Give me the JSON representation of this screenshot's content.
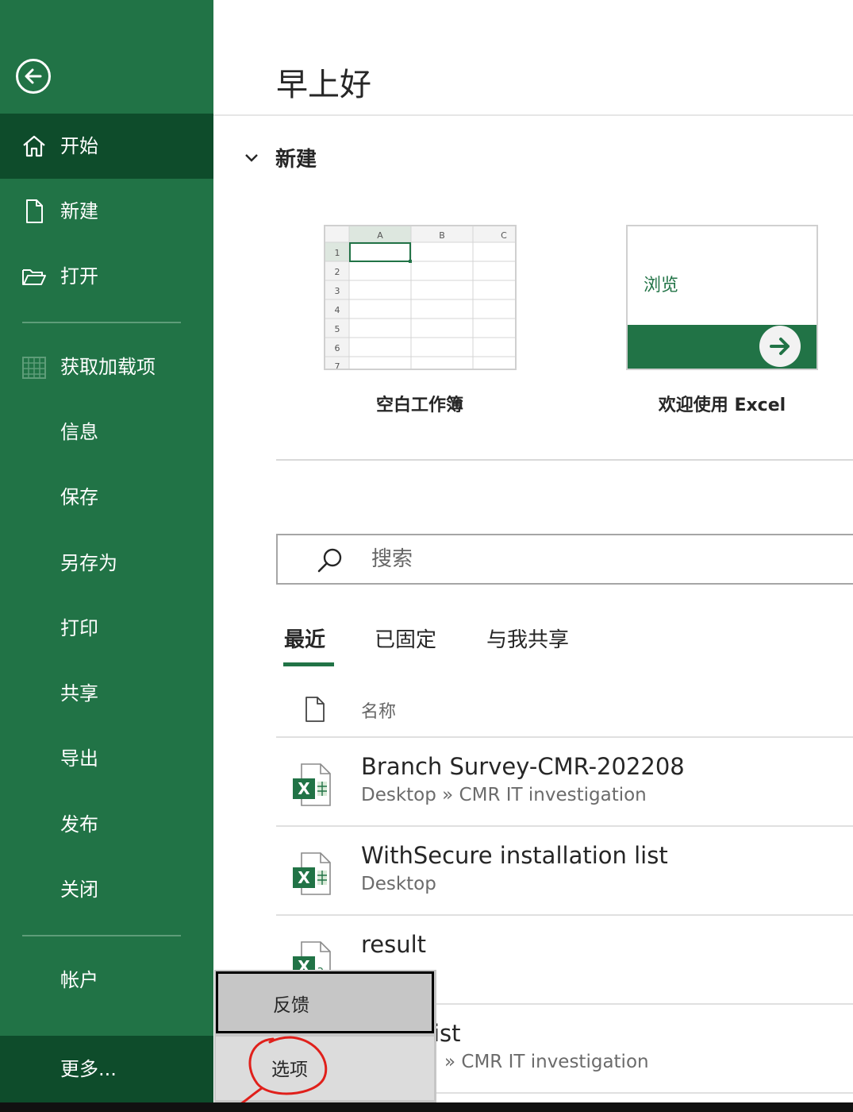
{
  "sidebar": {
    "nav": [
      {
        "label": "开始",
        "icon": "home-icon"
      },
      {
        "label": "新建",
        "icon": "new-document-icon"
      },
      {
        "label": "打开",
        "icon": "open-folder-icon"
      },
      {
        "label": "获取加载项",
        "icon": "add-ins-icon"
      },
      {
        "label": "信息"
      },
      {
        "label": "保存"
      },
      {
        "label": "另存为"
      },
      {
        "label": "打印"
      },
      {
        "label": "共享"
      },
      {
        "label": "导出"
      },
      {
        "label": "发布"
      },
      {
        "label": "关闭"
      },
      {
        "label": "帐户"
      }
    ],
    "more_label": "更多..."
  },
  "main": {
    "greeting": "早上好",
    "new_section": {
      "label": "新建",
      "templates": [
        {
          "caption": "空白工作簿",
          "preview_cols": [
            "A",
            "B",
            "C"
          ],
          "preview_rows": [
            "1",
            "2",
            "3",
            "4",
            "5",
            "6",
            "7"
          ]
        },
        {
          "caption": "欢迎使用 Excel",
          "preview_text": "浏览"
        }
      ]
    },
    "search": {
      "placeholder": "搜索"
    },
    "tabs": [
      {
        "label": "最近",
        "active": true
      },
      {
        "label": "已固定",
        "active": false
      },
      {
        "label": "与我共享",
        "active": false
      }
    ],
    "list_header": {
      "name_label": "名称"
    },
    "files": [
      {
        "name": "Branch Survey-CMR-202208",
        "path": "Desktop » CMR IT investigation"
      },
      {
        "name": "WithSecure installation list",
        "path": "Desktop"
      },
      {
        "name": "result",
        "path": ""
      },
      {
        "name": "ist",
        "path": "» CMR IT investigation"
      }
    ]
  },
  "popup_menu": {
    "items": [
      {
        "label": "反馈"
      },
      {
        "label": "选项"
      }
    ]
  },
  "colors": {
    "brand": "#217346",
    "sidebar_active": "#0e4c2b",
    "annotation_red": "#e0201b"
  }
}
